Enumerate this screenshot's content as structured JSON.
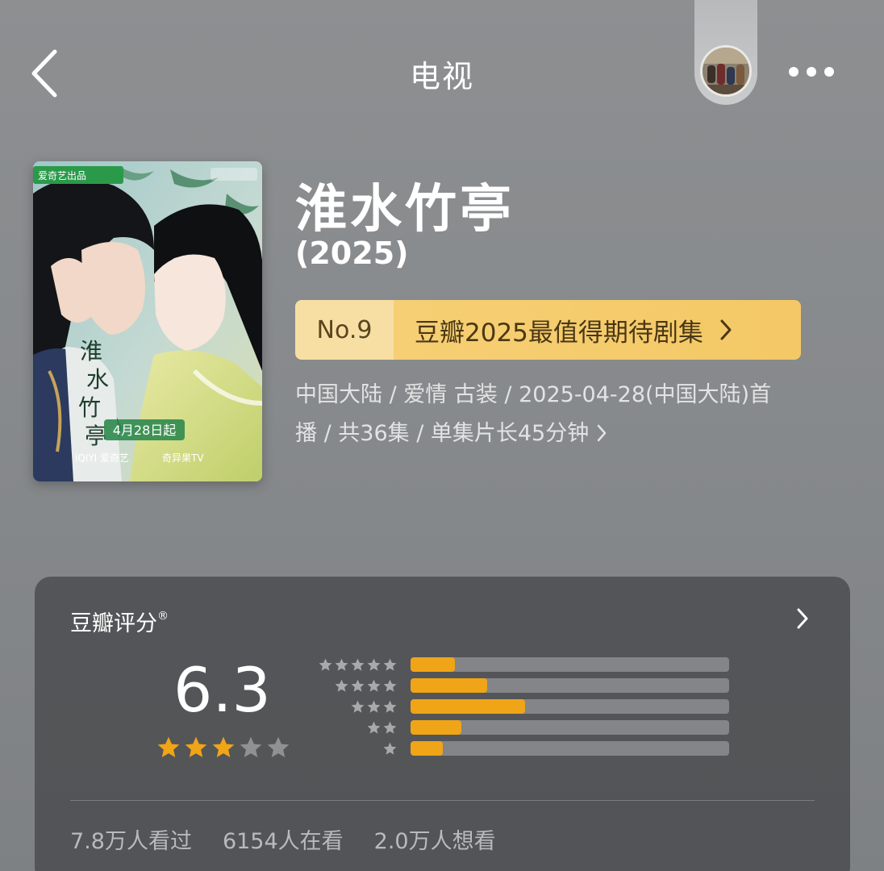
{
  "nav": {
    "title": "电视",
    "back_icon": "chevron-left-icon",
    "more_icon": "ellipsis-icon"
  },
  "show": {
    "title": "淮水竹亭",
    "year": "(2025)",
    "poster": {
      "badge_left": "爱奇艺出品",
      "calligraphy_title": "淮水竹亭",
      "date_text": "4月28日起",
      "platforms": [
        "iQIYI 爱奇艺",
        "奇异果TV"
      ]
    },
    "rank": {
      "number": "No.9",
      "label": "豆瓣2025最值得期待剧集"
    },
    "meta_line_1": "中国大陆 / 爱情 古装 / 2025-04-28(中国大陆)首",
    "meta_line_2": "播 / 共36集 / 单集片长45分钟"
  },
  "rating": {
    "label": "豆瓣评分",
    "registered_mark": "®",
    "score": "6.3",
    "stars_filled": 3,
    "stars_total": 5,
    "distribution": [
      {
        "stars": 5,
        "fraction": 0.14
      },
      {
        "stars": 4,
        "fraction": 0.24
      },
      {
        "stars": 3,
        "fraction": 0.36
      },
      {
        "stars": 2,
        "fraction": 0.16
      },
      {
        "stars": 1,
        "fraction": 0.1
      }
    ],
    "stats": {
      "watched": "7.8万人看过",
      "watching": "6154人在看",
      "want": "2.0万人想看"
    }
  },
  "colors": {
    "star_gold": "#f0a417",
    "rank_bg": "#f4c865",
    "card_bg": "#46484a"
  }
}
